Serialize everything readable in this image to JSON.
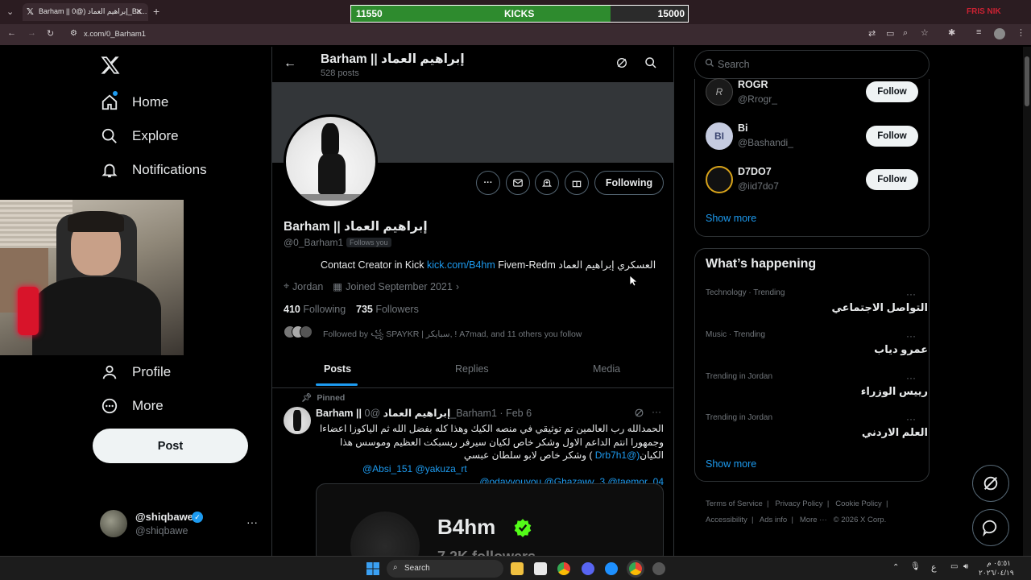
{
  "browser": {
    "tab_title": "Barham || إبراهيم العماد (@0_Ba...",
    "url": "x.com/0_Barham1",
    "window_label": "FRIS NIK"
  },
  "kicks_bar": {
    "current": "11550",
    "label": "KICKS",
    "goal": "15000",
    "progress": 0.77
  },
  "sidebar": {
    "items": [
      {
        "label": "Home",
        "icon": "home-icon"
      },
      {
        "label": "Explore",
        "icon": "search-icon"
      },
      {
        "label": "Notifications",
        "icon": "bell-icon"
      },
      {
        "label": "Profile",
        "icon": "person-icon"
      },
      {
        "label": "More",
        "icon": "more-circle-icon"
      }
    ],
    "post_label": "Post",
    "account": {
      "name": "@shiqbawe",
      "handle": "@shiqbawe"
    }
  },
  "profile": {
    "header_name": "Barham || إبراهيم العماد",
    "post_count": "528 posts",
    "name": "Barham || إبراهيم العماد",
    "handle": "@0_Barham1",
    "follows_you": "Follows you",
    "bio_prefix": "Contact Creator in Kick",
    "bio_link": "kick.com/B4hm",
    "bio_suffix": "Fivem-Redm العسكري إبراهيم العماد",
    "location": "Jordan",
    "joined": "Joined September 2021",
    "following_count": "410",
    "following_label": "Following",
    "followers_count": "735",
    "followers_label": "Followers",
    "followed_by": "Followed by ꧁ SPAYKR | سبايكر, ! A7mad, and 11 others you follow",
    "following_button": "Following",
    "tabs": [
      "Posts",
      "Replies",
      "Media"
    ]
  },
  "pinned_post": {
    "pinned_label": "Pinned",
    "author": "Barham || إبراهيم العماد",
    "handle": "@0_Barham1",
    "date": "· Feb 6",
    "line1": "الحمدالله رب العالمين تم توثيقي في منصه الكيك وهذا كله بفضل الله ثم الياكوزا اعضاءا",
    "line2": "وجمهورا انتم الداعم الاول وشكر خاص لكيان سيرفر ريسبكت العظيم وموسس هذا",
    "line3_text": "الكيان",
    "line3_mention": "(@Drb7h1",
    "line3_rest": ") وشكر خاص لابو سلطان عبسي",
    "mentions_a": "@Absi_151 @yakuza_rt",
    "mentions_b": "@odayyouyou @Ghazawy_3 @taemor_04",
    "card_name": "B4hm",
    "card_sub": "7.2K followers"
  },
  "right": {
    "search_placeholder": "Search",
    "suggestions": [
      {
        "name": "ROGR",
        "handle": "@Rrogr_",
        "button": "Follow"
      },
      {
        "name": "Bi",
        "handle": "@Bashandi_",
        "button": "Follow",
        "avatar_text": "BI"
      },
      {
        "name": "D7DO7",
        "handle": "@iid7do7",
        "button": "Follow"
      }
    ],
    "show_more": "Show more",
    "whats_happening": "What’s happening",
    "trends": [
      {
        "category": "Technology · Trending",
        "name": "التواصل الاجتماعي"
      },
      {
        "category": "Music · Trending",
        "name": "عمرو دياب"
      },
      {
        "category": "Trending in Jordan",
        "name": "رييس الوزراء"
      },
      {
        "category": "Trending in Jordan",
        "name": "العلم الاردني"
      }
    ],
    "show_more_2": "Show more",
    "footer": [
      "Terms of Service",
      "Privacy Policy",
      "Cookie Policy",
      "Accessibility",
      "Ads info",
      "More ···",
      "© 2026 X Corp."
    ]
  },
  "taskbar": {
    "search_label": "Search",
    "lang": "ع",
    "time": "٠٥:٥١ م",
    "date": "٢٠٢٦/٠٤/١٩"
  },
  "colors": {
    "accent": "#1d9bf0",
    "kicks_green": "#2e8b2e",
    "background": "#000000"
  }
}
